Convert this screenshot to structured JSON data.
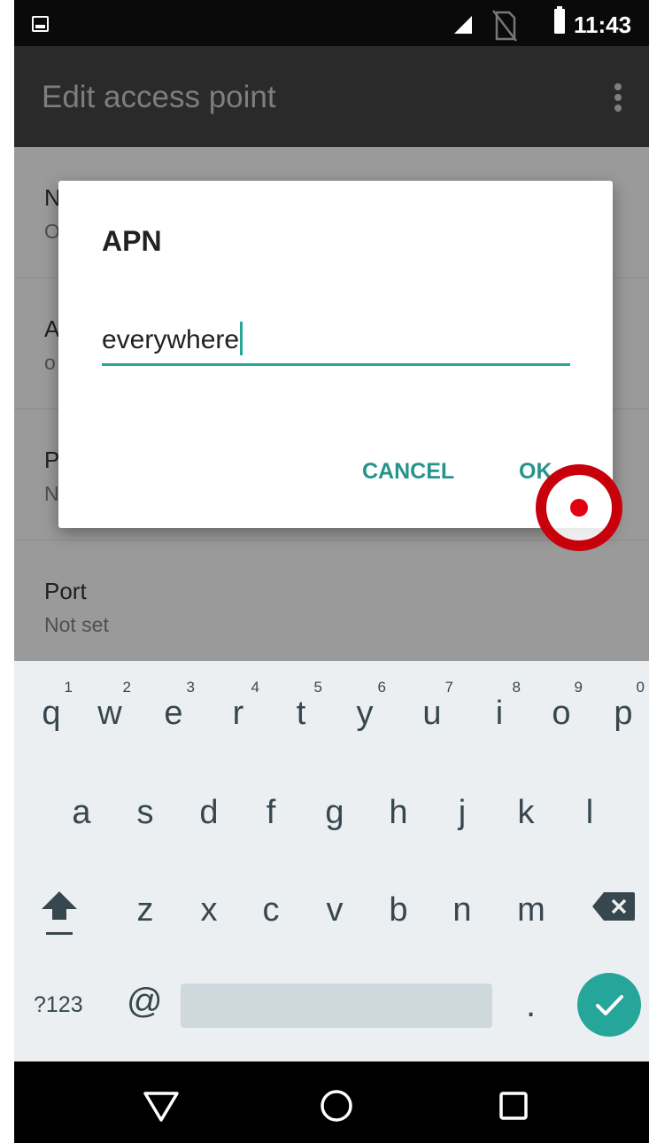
{
  "status_bar": {
    "time": "11:43",
    "icons": [
      "image-notification-icon",
      "signal-icon",
      "no-sim-icon",
      "battery-icon"
    ]
  },
  "action_bar": {
    "title": "Edit access point",
    "overflow_icon": "more-vert-icon"
  },
  "settings_list": [
    {
      "label": "N",
      "value": "O"
    },
    {
      "label": "A",
      "value": "o"
    },
    {
      "label": "P",
      "value": "N"
    },
    {
      "label": "Port",
      "value": "Not set"
    }
  ],
  "dialog": {
    "title": "APN",
    "input_value": "everywhere",
    "cancel_label": "CANCEL",
    "ok_label": "OK"
  },
  "keyboard": {
    "row1": [
      {
        "key": "q",
        "hint": "1"
      },
      {
        "key": "w",
        "hint": "2"
      },
      {
        "key": "e",
        "hint": "3"
      },
      {
        "key": "r",
        "hint": "4"
      },
      {
        "key": "t",
        "hint": "5"
      },
      {
        "key": "y",
        "hint": "6"
      },
      {
        "key": "u",
        "hint": "7"
      },
      {
        "key": "i",
        "hint": "8"
      },
      {
        "key": "o",
        "hint": "9"
      },
      {
        "key": "p",
        "hint": "0"
      }
    ],
    "row2": [
      "a",
      "s",
      "d",
      "f",
      "g",
      "h",
      "j",
      "k",
      "l"
    ],
    "row3": [
      "z",
      "x",
      "c",
      "v",
      "b",
      "n",
      "m"
    ],
    "symbols_label": "?123",
    "at_label": "@",
    "period_label": ".",
    "shift_icon": "shift-icon",
    "backspace_icon": "backspace-icon",
    "enter_icon": "check-icon"
  },
  "nav_bar": {
    "icons": [
      "back-triangle-icon",
      "home-circle-icon",
      "recents-square-icon"
    ]
  },
  "colors": {
    "accent": "#26a69a",
    "tap_marker": "#c8000b"
  }
}
